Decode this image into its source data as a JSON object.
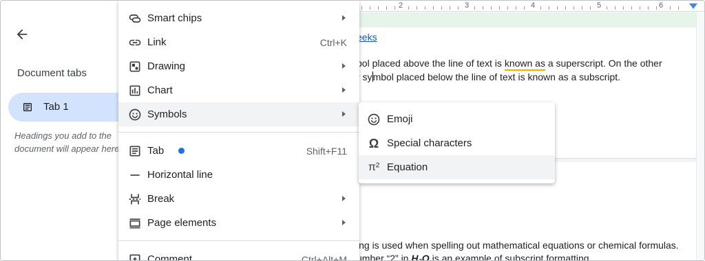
{
  "sidebar": {
    "title": "Document tabs",
    "tab": {
      "label": "Tab 1"
    },
    "hint": "Headings you add to the document will appear here."
  },
  "ruler": {
    "numbers": [
      "2",
      "3",
      "4",
      "5",
      "6"
    ]
  },
  "document": {
    "link_text": "eeks",
    "para1_line1_a": "bol placed above the line of text is ",
    "para1_line1_squiggle": "known as",
    "para1_line1_b": " a superscript. On the other",
    "para1_line2_a": "r sy",
    "para1_line2_b": "mbol placed below the line of text is known as a subscript.",
    "para2_line1": "ing is used when spelling out mathematical equations or chemical formulas.",
    "para2_line2_a": "umber “2” in ",
    "para2_line2_formula": "H₂O",
    "para2_line2_b": " is an example of subscript formatting."
  },
  "insert_menu": {
    "items": [
      {
        "label": "Smart chips",
        "icon": "smart-chips-icon",
        "shortcut": "",
        "submenu": true
      },
      {
        "label": "Link",
        "icon": "link-icon",
        "shortcut": "Ctrl+K",
        "submenu": false
      },
      {
        "label": "Drawing",
        "icon": "drawing-icon",
        "shortcut": "",
        "submenu": true
      },
      {
        "label": "Chart",
        "icon": "chart-icon",
        "shortcut": "",
        "submenu": true
      },
      {
        "label": "Symbols",
        "icon": "emoji-icon",
        "shortcut": "",
        "submenu": true
      },
      {
        "label": "Tab",
        "icon": "tab-doc-icon",
        "shortcut": "Shift+F11",
        "submenu": false,
        "new_badge_color": "#1a73e8"
      },
      {
        "label": "Horizontal line",
        "icon": "horizontal-line-icon",
        "shortcut": "",
        "submenu": false
      },
      {
        "label": "Break",
        "icon": "break-icon",
        "shortcut": "",
        "submenu": true
      },
      {
        "label": "Page elements",
        "icon": "page-elements-icon",
        "shortcut": "",
        "submenu": true
      },
      {
        "label": "Comment",
        "icon": "comment-icon",
        "shortcut": "Ctrl+Alt+M",
        "submenu": false
      }
    ]
  },
  "symbols_submenu": {
    "items": [
      {
        "label": "Emoji",
        "icon": "emoji-icon"
      },
      {
        "label": "Special characters",
        "icon": "omega-icon",
        "glyph": "Ω"
      },
      {
        "label": "Equation",
        "icon": "pi-squared-icon",
        "glyph": "π²"
      }
    ]
  },
  "colors": {
    "accent": "#1a73e8",
    "tab_selected": "#d3e3fd",
    "hover": "#f1f3f4",
    "link": "#1155cc"
  }
}
